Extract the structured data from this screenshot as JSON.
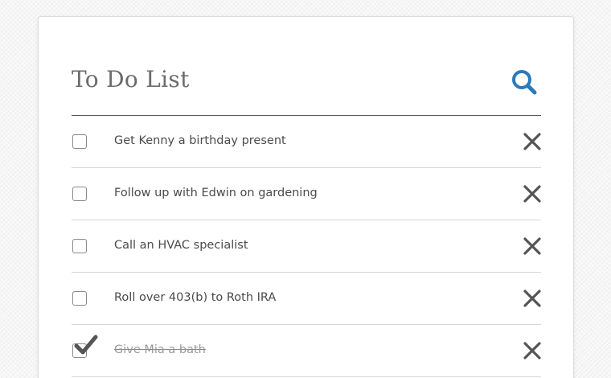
{
  "header": {
    "title": "To Do List",
    "search_icon": "search-icon"
  },
  "colors": {
    "accent": "#2b7bb9",
    "text": "#4a4a4a",
    "title": "#6b6b6b",
    "icon": "#555555"
  },
  "todos": [
    {
      "label": "Get Kenny a birthday present",
      "done": false
    },
    {
      "label": "Follow up with Edwin on gardening",
      "done": false
    },
    {
      "label": "Call an HVAC specialist",
      "done": false
    },
    {
      "label": "Roll over 403(b) to Roth IRA",
      "done": false
    },
    {
      "label": "Give Mia a bath",
      "done": true
    }
  ],
  "item_icons": {
    "delete": "close-icon",
    "checked": "checkmark-icon"
  }
}
